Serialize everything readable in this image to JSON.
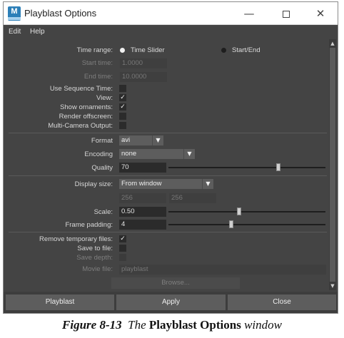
{
  "window": {
    "title": "Playblast Options",
    "app_icon": {
      "letter": "M",
      "name": "maya-app-icon"
    },
    "controls": {
      "minimize": "—",
      "maximize": "",
      "close": "✕"
    }
  },
  "menu": [
    "Edit",
    "Help"
  ],
  "time": {
    "range_label": "Time range:",
    "options": [
      "Time Slider",
      "Start/End"
    ],
    "selected": "Time Slider",
    "start_label": "Start time:",
    "start_value": "1.0000",
    "end_label": "End time:",
    "end_value": "10.0000",
    "use_seq_label": "Use Sequence Time:",
    "use_seq_checked": false,
    "view_label": "View:",
    "view_checked": true,
    "ornaments_label": "Show ornaments:",
    "ornaments_checked": true,
    "offscreen_label": "Render offscreen:",
    "offscreen_checked": false,
    "multicam_label": "Multi-Camera Output:",
    "multicam_checked": false
  },
  "format": {
    "format_label": "Format",
    "format_value": "avi",
    "encoding_label": "Encoding",
    "encoding_value": "none",
    "quality_label": "Quality",
    "quality_value": "70",
    "quality_slider": 0.7
  },
  "display": {
    "size_label": "Display size:",
    "size_value": "From window",
    "width": "256",
    "height": "256",
    "scale_label": "Scale:",
    "scale_value": "0.50",
    "scale_slider": 0.45,
    "padding_label": "Frame padding:",
    "padding_value": "4",
    "padding_slider": 0.4
  },
  "file": {
    "remove_label": "Remove temporary files:",
    "remove_checked": true,
    "save_file_label": "Save to file:",
    "save_file_checked": false,
    "save_depth_label": "Save depth:",
    "save_depth_checked": false,
    "movie_label": "Movie file:",
    "movie_placeholder": "playblast",
    "browse_label": "Browse..."
  },
  "buttons": {
    "playblast": "Playblast",
    "apply": "Apply",
    "close": "Close"
  },
  "caption": {
    "number": "Figure 8-13",
    "pre": "The",
    "name": "Playblast Options",
    "post": "window"
  },
  "colors": {
    "panel": "#444444",
    "field": "#2b2b2b",
    "button": "#5d5d5d"
  }
}
